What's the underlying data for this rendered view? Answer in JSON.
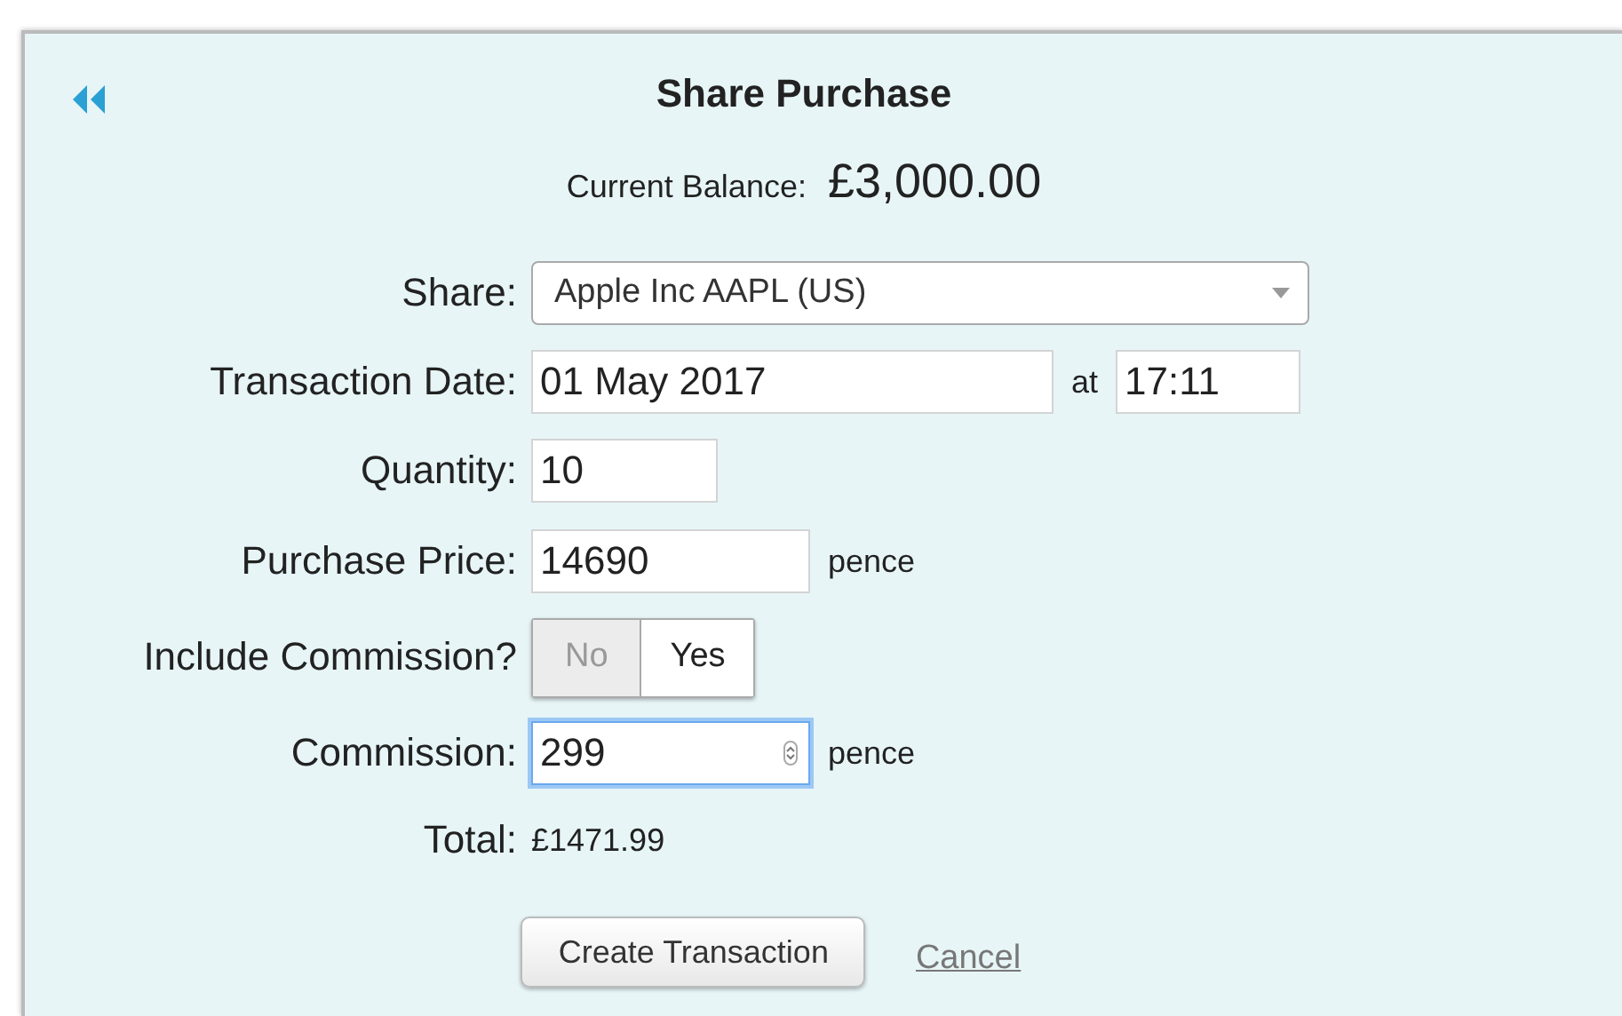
{
  "title": "Share Purchase",
  "balance": {
    "label": "Current Balance:",
    "value": "£3,000.00"
  },
  "share": {
    "label": "Share:",
    "value": "Apple Inc AAPL (US)"
  },
  "date": {
    "label": "Transaction Date:",
    "value": "01 May 2017",
    "at": "at",
    "time": "17:11"
  },
  "quantity": {
    "label": "Quantity:",
    "value": "10"
  },
  "price": {
    "label": "Purchase Price:",
    "value": "14690",
    "unit": "pence"
  },
  "include_commission": {
    "label": "Include Commission?",
    "options": [
      {
        "label": "No",
        "selected": false
      },
      {
        "label": "Yes",
        "selected": true
      }
    ]
  },
  "commission": {
    "label": "Commission:",
    "value": "299",
    "unit": "pence",
    "focused": true
  },
  "total": {
    "label": "Total:",
    "value": "£1471.99"
  },
  "buttons": {
    "create": "Create Transaction",
    "cancel": "Cancel"
  }
}
